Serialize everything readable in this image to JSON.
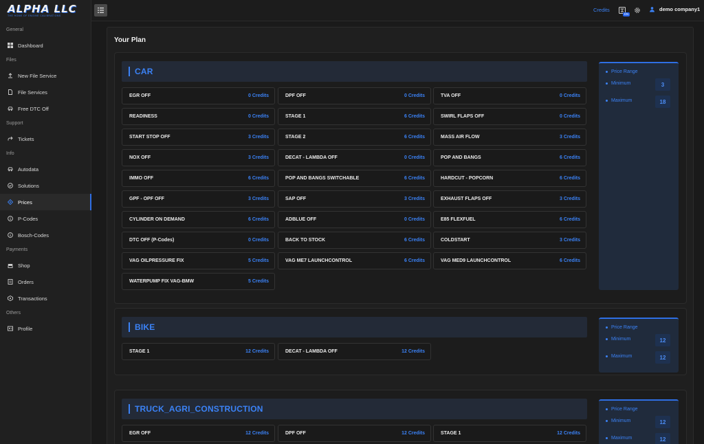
{
  "logo": {
    "title": "ALPHA LLC",
    "tagline": "THE HOME OF ENGINE CALIBRATIONS"
  },
  "sidebar": {
    "sections": [
      {
        "title": "General",
        "items": [
          {
            "label": "Dashboard",
            "icon": "dashboard-icon"
          }
        ]
      },
      {
        "title": "Files",
        "items": [
          {
            "label": "New File Service",
            "icon": "upload-icon"
          },
          {
            "label": "File Services",
            "icon": "file-icon"
          },
          {
            "label": "Free DTC Off",
            "icon": "car-icon"
          }
        ]
      },
      {
        "title": "Support",
        "items": [
          {
            "label": "Tickets",
            "icon": "ticket-icon"
          }
        ]
      },
      {
        "title": "Info",
        "items": [
          {
            "label": "Autodata",
            "icon": "car-icon"
          },
          {
            "label": "Solutions",
            "icon": "check-circle-icon"
          },
          {
            "label": "Prices",
            "icon": "tag-icon",
            "active": true
          },
          {
            "label": "P-Codes",
            "icon": "info-icon"
          },
          {
            "label": "Bosch-Codes",
            "icon": "info-icon"
          }
        ]
      },
      {
        "title": "Payments",
        "items": [
          {
            "label": "Shop",
            "icon": "shop-icon"
          },
          {
            "label": "Orders",
            "icon": "orders-icon"
          },
          {
            "label": "Transactions",
            "icon": "transactions-icon"
          }
        ]
      },
      {
        "title": "Others",
        "items": [
          {
            "label": "Profile",
            "icon": "profile-icon"
          }
        ]
      }
    ]
  },
  "topbar": {
    "credits_label": "Credits",
    "lang": "EN",
    "user_name": "demo company1"
  },
  "main": {
    "title": "Your Plan"
  },
  "range_labels": {
    "title": "Price Range",
    "min": "Minimum",
    "max": "Maximum"
  },
  "categories": [
    {
      "name": "CAR",
      "min": "3",
      "max": "18",
      "services": [
        {
          "name": "EGR OFF",
          "price": "0 Credits"
        },
        {
          "name": "DPF OFF",
          "price": "0 Credits"
        },
        {
          "name": "TVA OFF",
          "price": "0 Credits"
        },
        {
          "name": "READINESS",
          "price": "0 Credits"
        },
        {
          "name": "STAGE 1",
          "price": "6 Credits"
        },
        {
          "name": "SWIRL FLAPS OFF",
          "price": "0 Credits"
        },
        {
          "name": "START STOP OFF",
          "price": "3 Credits"
        },
        {
          "name": "STAGE 2",
          "price": "6 Credits"
        },
        {
          "name": "MASS AIR FLOW",
          "price": "3 Credits"
        },
        {
          "name": "NOX OFF",
          "price": "3 Credits"
        },
        {
          "name": "DECAT - LAMBDA OFF",
          "price": "0 Credits"
        },
        {
          "name": "POP AND BANGS",
          "price": "6 Credits"
        },
        {
          "name": "IMMO OFF",
          "price": "6 Credits"
        },
        {
          "name": "POP AND BANGS SWITCHABLE",
          "price": "6 Credits"
        },
        {
          "name": "HARDCUT - POPCORN",
          "price": "6 Credits"
        },
        {
          "name": "GPF - OPF OFF",
          "price": "3 Credits"
        },
        {
          "name": "SAP OFF",
          "price": "3 Credits"
        },
        {
          "name": "EXHAUST FLAPS OFF",
          "price": "3 Credits"
        },
        {
          "name": "CYLINDER ON DEMAND",
          "price": "6 Credits"
        },
        {
          "name": "ADBLUE OFF",
          "price": "0 Credits"
        },
        {
          "name": "E85 FLEXFUEL",
          "price": "6 Credits"
        },
        {
          "name": "DTC OFF (P-Codes)",
          "price": "0 Credits"
        },
        {
          "name": "BACK TO STOCK",
          "price": "6 Credits"
        },
        {
          "name": "COLDSTART",
          "price": "3 Credits"
        },
        {
          "name": "VAG OILPRESSURE FIX",
          "price": "5 Credits"
        },
        {
          "name": "VAG ME7 LAUNCHCONTROL",
          "price": "6 Credits"
        },
        {
          "name": "VAG MED9 LAUNCHCONTROL",
          "price": "6 Credits"
        },
        {
          "name": "WATERPUMP FIX VAG-BMW",
          "price": "5 Credits"
        }
      ]
    },
    {
      "name": "BIKE",
      "min": "12",
      "max": "12",
      "services": [
        {
          "name": "STAGE 1",
          "price": "12 Credits"
        },
        {
          "name": "DECAT - LAMBDA OFF",
          "price": "12 Credits"
        }
      ]
    },
    {
      "name": "TRUCK_AGRI_CONSTRUCTION",
      "min": "12",
      "max": "12",
      "services": [
        {
          "name": "EGR OFF",
          "price": "12 Credits"
        },
        {
          "name": "DPF OFF",
          "price": "12 Credits"
        },
        {
          "name": "STAGE 1",
          "price": "12 Credits"
        }
      ]
    }
  ]
}
